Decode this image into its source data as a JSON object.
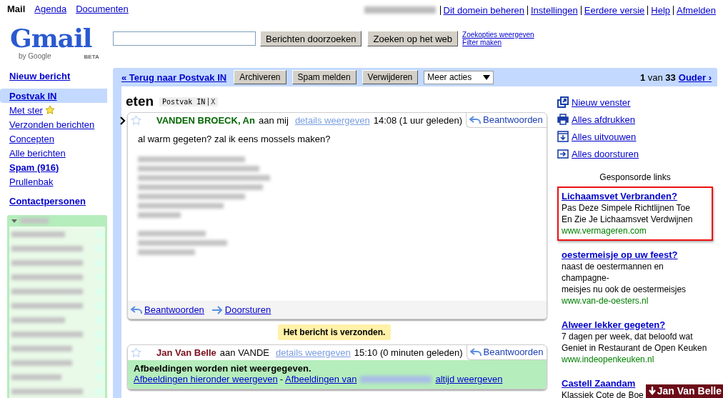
{
  "top_nav": {
    "apps": [
      {
        "label": "Mail",
        "selected": true
      },
      {
        "label": "Agenda",
        "selected": false
      },
      {
        "label": "Documenten",
        "selected": false
      }
    ],
    "account_links": [
      "Dit domein beheren",
      "Instellingen",
      "Eerdere versie",
      "Help",
      "Afmelden"
    ]
  },
  "logo": {
    "name": "Gmail",
    "tagline": "by Google",
    "badge": "BETA"
  },
  "search": {
    "buttons": [
      "Berichten doorzoeken",
      "Zoeken op het web"
    ],
    "links": [
      "Zoekopties weergeven",
      "Filter maken"
    ]
  },
  "sidebar": {
    "compose": "Nieuw bericht",
    "folders": [
      {
        "label": "Postvak IN",
        "selected": true,
        "bold": true,
        "kind": "plain"
      },
      {
        "label": "Met ster",
        "selected": false,
        "bold": false,
        "kind": "star"
      },
      {
        "label": "Verzonden berichten",
        "selected": false,
        "bold": false,
        "kind": "plain"
      },
      {
        "label": "Concepten",
        "selected": false,
        "bold": false,
        "kind": "plain"
      },
      {
        "label": "Alle berichten",
        "selected": false,
        "bold": false,
        "kind": "plain"
      },
      {
        "label": "Spam (916)",
        "selected": false,
        "bold": true,
        "kind": "plain"
      },
      {
        "label": "Prullenbak",
        "selected": false,
        "bold": false,
        "kind": "plain"
      }
    ],
    "contacts": "Contactpersonen"
  },
  "toolbar": {
    "back": "« Terug naar Postvak IN",
    "buttons": [
      "Archiveren",
      "Spam melden",
      "Verwijderen"
    ],
    "more_actions": "Meer acties",
    "pager": {
      "current": "1",
      "of": "van",
      "total": "33",
      "next": "Ouder ›"
    }
  },
  "conversation": {
    "subject": "eten",
    "label": "Postvak IN",
    "label_remove": "X",
    "messages": [
      {
        "current": true,
        "starred": false,
        "sender": "VANDEN BROECK, An",
        "color": "#006600",
        "recipient": "aan mij",
        "details": "details weergeven",
        "time": "14:08 (1 uur geleden)",
        "reply": "Beantwoorden",
        "body": "al warm gegeten? zal ik eens mossels maken?",
        "footer_actions": [
          "Beantwoorden",
          "Doorsturen"
        ]
      },
      {
        "current": false,
        "starred": false,
        "sender": "Jan Van Belle",
        "color": "#7a0f1c",
        "recipient": "aan VANDE",
        "details": "details weergeven",
        "time": "15:10 (0 minuten geleden)",
        "reply": "Beantwoorden",
        "images_notice": {
          "title": "Afbeeldingen worden niet weergegeven.",
          "show_link": "Afbeeldingen hieronder weergeven",
          "separator": "-",
          "always_prefix": "Afbeeldingen van",
          "always_suffix": "altijd weergeven"
        }
      }
    ],
    "sent_notice": "Het bericht is verzonden."
  },
  "actions": [
    {
      "label": "Nieuw venster",
      "kind": "new-window"
    },
    {
      "label": "Alles afdrukken",
      "kind": "print"
    },
    {
      "label": "Alles uitvouwen",
      "kind": "expand"
    },
    {
      "label": "Alles doorsturen",
      "kind": "forward"
    }
  ],
  "sponsored": {
    "title": "Gesponsorde links",
    "ads": [
      {
        "title": "Lichaamsvet Verbranden?",
        "lines": [
          "Pas Deze Simpele Richtlijnen Toe",
          "En Zie Je Lichaamsvet Verdwijnen"
        ],
        "url": "www.vermageren.com",
        "highlighted": true
      },
      {
        "title": "oestermeisje op uw feest?",
        "lines": [
          "naast de oestermannen en",
          "champagne-",
          "meisjes nu ook de oestermeisjes"
        ],
        "url": "www.van-de-oesters.nl",
        "highlighted": false
      },
      {
        "title": "Alweer lekker gegeten?",
        "lines": [
          "7 dagen per week, dat beloofd wat",
          "Geniet in Restaurant de Open Keuken"
        ],
        "url": "www.indeopenkeuken.nl",
        "highlighted": false
      },
      {
        "title": "Castell Zaandam",
        "lines": [
          "Klassiek Cote de Boe"
        ],
        "highlighted": false
      }
    ]
  },
  "chat_tag": "Jan Van Belle"
}
